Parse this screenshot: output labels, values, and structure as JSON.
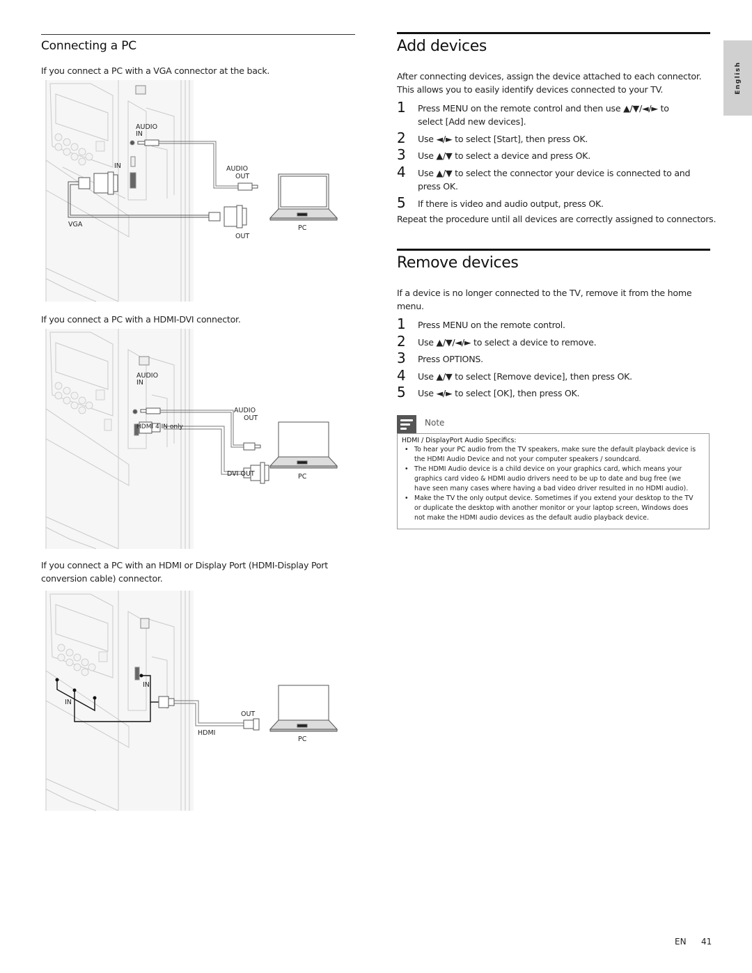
{
  "side_tab": {
    "label": "English"
  },
  "left": {
    "section_title": "Connecting a PC",
    "vga": {
      "caption": "If you connect a PC with a VGA connector at the back.",
      "labels": {
        "audio_in_1": "AUDIO",
        "audio_in_2": "IN",
        "in": "IN",
        "audio_out_1": "AUDIO",
        "audio_out_2": "OUT",
        "vga": "VGA",
        "out": "OUT",
        "pc": "PC"
      }
    },
    "hdmi_dvi": {
      "caption": "If you connect a PC with a HDMI-DVI connector.",
      "labels": {
        "audio_in_1": "AUDIO",
        "audio_in_2": "IN",
        "audio_out_1": "AUDIO",
        "audio_out_2": "OUT",
        "hdmi4": "HDMI 4 IN only",
        "dvi_out": "DVI OUT",
        "pc": "PC"
      }
    },
    "hdmi_dp": {
      "caption_line1": "If you connect a PC with an HDMI or Display Port (HDMI-Display Port",
      "caption_line2": "conversion cable) connector.",
      "labels": {
        "in_right": "IN",
        "in_left": "IN",
        "out": "OUT",
        "hdmi": "HDMI",
        "pc": "PC"
      }
    }
  },
  "add_devices": {
    "title": "Add devices",
    "intro_line1": "After connecting devices, assign the device attached to each connector.",
    "intro_line2": "This allows you to easily identify devices connected to your TV.",
    "steps": [
      {
        "num": "1",
        "line1": "Press MENU on the remote control and then use ▲/▼/◄/► to",
        "line2": "select [Add new devices]."
      },
      {
        "num": "2",
        "line1": "Use ◄/► to select [Start], then press OK."
      },
      {
        "num": "3",
        "line1": "Use ▲/▼ to select a device and press OK."
      },
      {
        "num": "4",
        "line1": "Use ▲/▼ to select the connector your device is connected to and",
        "line2": "press OK."
      },
      {
        "num": "5",
        "line1": "If there is video and audio output, press OK."
      }
    ],
    "outro": "Repeat the procedure until all devices are correctly assigned to connectors."
  },
  "remove_devices": {
    "title": "Remove devices",
    "intro_line1": "If a device is no longer connected to the TV, remove it from the home",
    "intro_line2": "menu.",
    "steps": [
      {
        "num": "1",
        "line1": "Press MENU on the remote control."
      },
      {
        "num": "2",
        "line1": "Use ▲/▼/◄/► to select a device to remove."
      },
      {
        "num": "3",
        "line1": "Press OPTIONS."
      },
      {
        "num": "4",
        "line1": "Use ▲/▼ to select [Remove device], then press OK."
      },
      {
        "num": "5",
        "line1": "Use ◄/► to select [OK], then press OK."
      }
    ]
  },
  "note": {
    "label": "Note",
    "title": "HDMI / DisplayPort Audio Specifics:",
    "bullets": [
      {
        "line1": "To hear your PC audio from the TV speakers, make sure the default playback device is",
        "line2": "the HDMI Audio Device and not your computer speakers / soundcard."
      },
      {
        "line1": "The HDMI Audio device is a child device on your graphics card, which means your",
        "line2": "graphics card video & HDMI audio drivers need to be up to date and bug free (we",
        "line3": "have seen many cases where having a bad video driver resulted in no HDMI audio)."
      },
      {
        "line1": "Make the TV the only output device. Sometimes if you extend your desktop to the TV",
        "line2": "or duplicate the desktop with another monitor or your laptop screen, Windows does",
        "line3": "not make the HDMI audio devices as the default audio playback device."
      }
    ]
  },
  "footer": {
    "lang": "EN",
    "page": "41"
  }
}
